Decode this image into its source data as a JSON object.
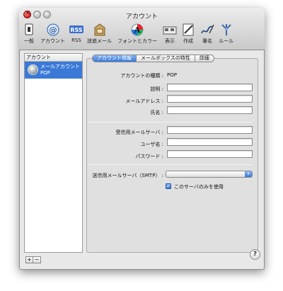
{
  "window": {
    "title": "アカウント"
  },
  "toolbar": [
    {
      "label": "一般",
      "icon": "switch-icon"
    },
    {
      "label": "アカウント",
      "icon": "at-icon"
    },
    {
      "label": "RSS",
      "icon": "rss-icon"
    },
    {
      "label": "迷惑メール",
      "icon": "junk-mail-icon"
    },
    {
      "label": "フォントとカラー",
      "icon": "font-color-icon"
    },
    {
      "label": "表示",
      "icon": "viewing-icon"
    },
    {
      "label": "作成",
      "icon": "compose-icon"
    },
    {
      "label": "署名",
      "icon": "signature-icon"
    },
    {
      "label": "ルール",
      "icon": "rules-icon"
    }
  ],
  "accounts": {
    "header": "アカウント",
    "items": [
      {
        "name": "メールアカウント",
        "type": "POP"
      }
    ],
    "add_label": "+",
    "remove_label": "−"
  },
  "tabs": [
    "アカウント情報",
    "メールボックスの特性",
    "詳細"
  ],
  "form": {
    "account_type_label": "アカウントの種類 :",
    "account_type_value": "POP",
    "description_label": "説明 :",
    "email_label": "メールアドレス :",
    "fullname_label": "氏名 :",
    "incoming_server_label": "受信用メールサーバ :",
    "username_label": "ユーザ名 :",
    "password_label": "パスワード :",
    "smtp_label": "送信用メールサーバ（SMTP） :",
    "smtp_value": "",
    "only_this_server_label": "このサーバのみを使用",
    "only_this_server_checked": true
  },
  "help": {
    "label": "?"
  },
  "colors": {
    "selection": "#3a79d6",
    "close_button": "#d21e1e"
  }
}
